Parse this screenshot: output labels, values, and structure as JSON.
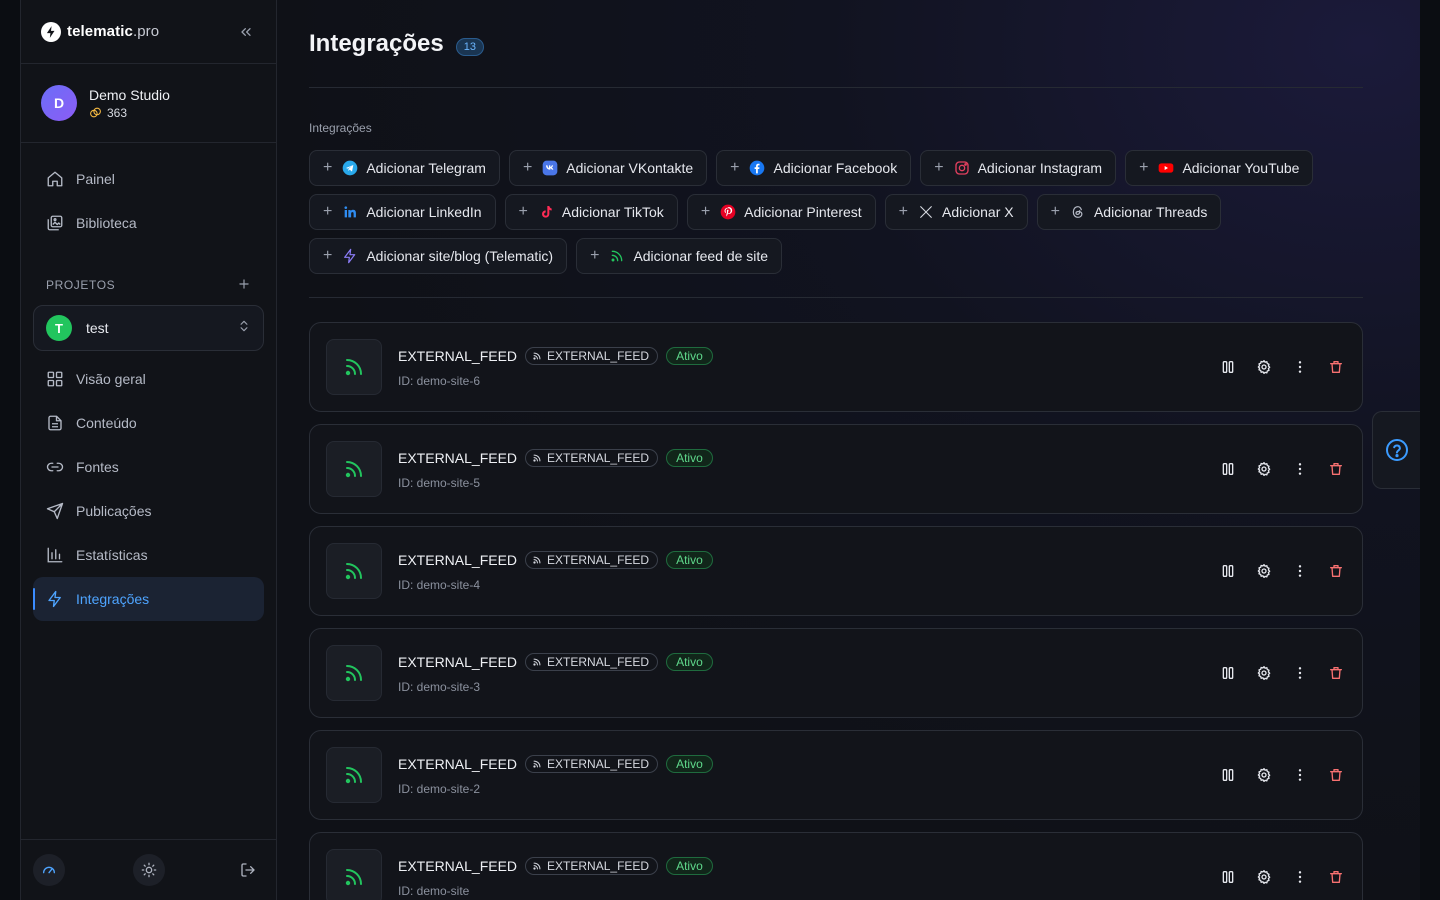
{
  "brand": {
    "name": "telematic",
    "domain": ".pro"
  },
  "account": {
    "initial": "D",
    "name": "Demo Studio",
    "credits": "363"
  },
  "nav": [
    {
      "label": "Painel",
      "icon": "home-icon"
    },
    {
      "label": "Biblioteca",
      "icon": "library-icon"
    }
  ],
  "projects": {
    "title": "PROJETOS",
    "selected_initial": "T",
    "selected_name": "test"
  },
  "project_nav": [
    {
      "label": "Visão geral",
      "icon": "grid-icon"
    },
    {
      "label": "Conteúdo",
      "icon": "document-icon"
    },
    {
      "label": "Fontes",
      "icon": "link-icon"
    },
    {
      "label": "Publicações",
      "icon": "send-icon"
    },
    {
      "label": "Estatísticas",
      "icon": "bar-chart-icon"
    },
    {
      "label": "Integrações",
      "icon": "bolt-icon",
      "active": true
    }
  ],
  "page": {
    "title": "Integrações",
    "count": "13",
    "section_label": "Integrações"
  },
  "chips": [
    {
      "label": "Adicionar Telegram",
      "icon": "telegram-icon",
      "color": "#29a9eb"
    },
    {
      "label": "Adicionar VKontakte",
      "icon": "vk-icon",
      "color": "#4a76e8"
    },
    {
      "label": "Adicionar Facebook",
      "icon": "facebook-icon",
      "color": "#1877f2"
    },
    {
      "label": "Adicionar Instagram",
      "icon": "instagram-icon",
      "color": "#e4405f"
    },
    {
      "label": "Adicionar YouTube",
      "icon": "youtube-icon",
      "color": "#ff0000"
    },
    {
      "label": "Adicionar LinkedIn",
      "icon": "linkedin-icon",
      "color": "#2f8cf0"
    },
    {
      "label": "Adicionar TikTok",
      "icon": "tiktok-icon",
      "color": "#ff2b55"
    },
    {
      "label": "Adicionar Pinterest",
      "icon": "pinterest-icon",
      "color": "#e60023"
    },
    {
      "label": "Adicionar X",
      "icon": "x-icon",
      "color": "#d6d9e0"
    },
    {
      "label": "Adicionar Threads",
      "icon": "threads-icon",
      "color": "#b5bac6"
    },
    {
      "label": "Adicionar site/blog (Telematic)",
      "icon": "bolt-icon",
      "color": "#8b7cf6"
    },
    {
      "label": "Adicionar feed de site",
      "icon": "rss-icon",
      "color": "#22c55e"
    }
  ],
  "integrations": [
    {
      "name": "EXTERNAL_FEED",
      "type": "EXTERNAL_FEED",
      "status": "Ativo",
      "id": "ID: demo-site-6"
    },
    {
      "name": "EXTERNAL_FEED",
      "type": "EXTERNAL_FEED",
      "status": "Ativo",
      "id": "ID: demo-site-5"
    },
    {
      "name": "EXTERNAL_FEED",
      "type": "EXTERNAL_FEED",
      "status": "Ativo",
      "id": "ID: demo-site-4"
    },
    {
      "name": "EXTERNAL_FEED",
      "type": "EXTERNAL_FEED",
      "status": "Ativo",
      "id": "ID: demo-site-3"
    },
    {
      "name": "EXTERNAL_FEED",
      "type": "EXTERNAL_FEED",
      "status": "Ativo",
      "id": "ID: demo-site-2"
    },
    {
      "name": "EXTERNAL_FEED",
      "type": "EXTERNAL_FEED",
      "status": "Ativo",
      "id": "ID: demo-site"
    }
  ],
  "colors": {
    "accent": "#4ea4ff",
    "success": "#5fd88b",
    "danger": "#f87171",
    "rss": "#22c55e"
  }
}
